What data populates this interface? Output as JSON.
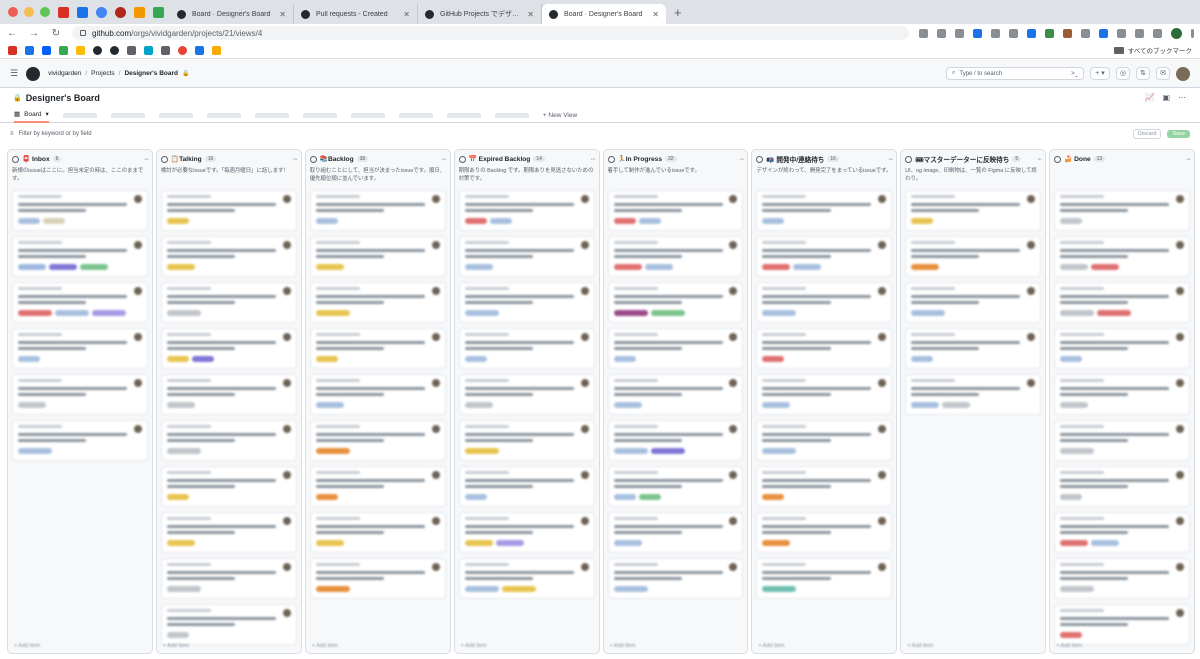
{
  "browser": {
    "tabs": [
      {
        "title": "Board · Designer's Board",
        "active": false
      },
      {
        "title": "Pull requests - Created",
        "active": false
      },
      {
        "title": "GitHub Projects でデザインチ…",
        "active": false
      },
      {
        "title": "Board · Designer's Board",
        "active": true
      }
    ],
    "new_tab": "+",
    "url_domain": "github.com",
    "url_path": "/orgs/vividgarden/projects/21/views/4",
    "bookmarks_all": "すべてのブックマーク"
  },
  "header": {
    "org": "vividgarden",
    "projects": "Projects",
    "board": "Designer's Board",
    "search_placeholder": "Type / to search"
  },
  "project": {
    "title": "Designer's Board",
    "view_tab": "Board",
    "new_view": "New View",
    "filter_placeholder": "Filter by keyword or by field",
    "discard": "Discard",
    "save": "Save"
  },
  "columns": [
    {
      "name": "📮 Inbox",
      "count": "6",
      "desc": "新規のissueはここに。担当未定の時は、ここのままです。",
      "cards": [
        {
          "labels": [
            "#a8c0e0",
            "#d8d0b8"
          ]
        },
        {
          "labels": [
            "#9fb8e0",
            "#7f76d6",
            "#7bc48c"
          ]
        },
        {
          "labels": [
            "#e07070",
            "#a8c0e0",
            "#a99ae6"
          ]
        },
        {
          "labels": [
            "#a8c0e0"
          ]
        },
        {
          "labels": [
            "#c0c6cc"
          ]
        },
        {
          "labels": [
            "#a8c0e0"
          ]
        }
      ]
    },
    {
      "name": "📋Talking",
      "count": "16",
      "desc": "検討が必要なissueです。「毎週月曜日」に話します！",
      "cards": [
        {
          "labels": [
            "#e8c44f"
          ]
        },
        {
          "labels": [
            "#e8c44f"
          ]
        },
        {
          "labels": [
            "#c0c6cc"
          ]
        },
        {
          "labels": [
            "#e8c44f",
            "#7f76d6"
          ]
        },
        {
          "labels": [
            "#c0c6cc"
          ]
        },
        {
          "labels": [
            "#c0c6cc"
          ]
        },
        {
          "labels": [
            "#e8c44f"
          ]
        },
        {
          "labels": [
            "#e8c44f"
          ]
        },
        {
          "labels": [
            "#c0c6cc"
          ]
        },
        {
          "labels": [
            "#c0c6cc"
          ]
        }
      ]
    },
    {
      "name": "📚Backlog",
      "count": "38",
      "desc": "取り組むことにして、担当が決まったissueです。順日、優先順位順に並んでいます。",
      "cards": [
        {
          "labels": [
            "#a8c0e0"
          ]
        },
        {
          "labels": [
            "#e8c44f"
          ]
        },
        {
          "labels": [
            "#e8c44f"
          ]
        },
        {
          "labels": [
            "#e8c44f"
          ]
        },
        {
          "labels": [
            "#a8c0e0"
          ]
        },
        {
          "labels": [
            "#e9903f"
          ]
        },
        {
          "labels": [
            "#e9903f"
          ]
        },
        {
          "labels": [
            "#e8c44f"
          ]
        },
        {
          "labels": [
            "#e9903f"
          ]
        }
      ]
    },
    {
      "name": "📅 Expired Backlog",
      "count": "14",
      "desc": "期限ありの Backlog です。期限ありを見逃さないための対策です。",
      "cards": [
        {
          "labels": [
            "#e07070",
            "#a8c0e0"
          ]
        },
        {
          "labels": [
            "#a8c0e0"
          ]
        },
        {
          "labels": [
            "#a8c0e0"
          ]
        },
        {
          "labels": [
            "#a8c0e0"
          ]
        },
        {
          "labels": [
            "#c0c6cc"
          ]
        },
        {
          "labels": [
            "#e8c44f"
          ]
        },
        {
          "labels": [
            "#a8c0e0"
          ]
        },
        {
          "labels": [
            "#e8c44f",
            "#a99ae6"
          ]
        },
        {
          "labels": [
            "#a8c0e0",
            "#e8c44f"
          ]
        }
      ]
    },
    {
      "name": "🏃In Progress",
      "count": "32",
      "desc": "着手して制作が進んでいるissueです。",
      "cards": [
        {
          "labels": [
            "#e07070",
            "#a8c0e0"
          ]
        },
        {
          "labels": [
            "#e07070",
            "#a8c0e0"
          ]
        },
        {
          "labels": [
            "#9b4a8a",
            "#7bc48c"
          ]
        },
        {
          "labels": [
            "#a8c0e0"
          ]
        },
        {
          "labels": [
            "#a8c0e0"
          ]
        },
        {
          "labels": [
            "#a8c0e0",
            "#7f76d6"
          ]
        },
        {
          "labels": [
            "#a8c0e0",
            "#7bc48c"
          ]
        },
        {
          "labels": [
            "#a8c0e0"
          ]
        },
        {
          "labels": [
            "#a8c0e0"
          ]
        }
      ]
    },
    {
      "name": "📭 開発中/連絡待ち",
      "count": "16",
      "desc": "デザインが終わって、開発完了をまっているissueです。",
      "cards": [
        {
          "labels": [
            "#a8c0e0"
          ]
        },
        {
          "labels": [
            "#e07070",
            "#a8c0e0"
          ]
        },
        {
          "labels": [
            "#a8c0e0"
          ]
        },
        {
          "labels": [
            "#e07070"
          ]
        },
        {
          "labels": [
            "#a8c0e0"
          ]
        },
        {
          "labels": [
            "#a8c0e0"
          ]
        },
        {
          "labels": [
            "#e9903f"
          ]
        },
        {
          "labels": [
            "#e9903f"
          ]
        },
        {
          "labels": [
            "#6fbfb0"
          ]
        }
      ]
    },
    {
      "name": "🎟マスターデーターに反映待ち",
      "count": "5",
      "desc": "UI、og image、印刷物は、一覧の Figma に反映して終わり。",
      "cards": [
        {
          "labels": [
            "#e8c44f"
          ]
        },
        {
          "labels": [
            "#e9903f"
          ]
        },
        {
          "labels": [
            "#a8c0e0"
          ]
        },
        {
          "labels": [
            "#a8c0e0"
          ]
        },
        {
          "labels": [
            "#a8c0e0",
            "#c0c6cc"
          ]
        }
      ]
    },
    {
      "name": "🍰 Done",
      "count": "13",
      "desc": "",
      "cards": [
        {
          "labels": [
            "#c0c6cc"
          ]
        },
        {
          "labels": [
            "#c0c6cc",
            "#e07070"
          ]
        },
        {
          "labels": [
            "#c0c6cc",
            "#e07070"
          ]
        },
        {
          "labels": [
            "#a8c0e0"
          ]
        },
        {
          "labels": [
            "#c0c6cc"
          ]
        },
        {
          "labels": [
            "#c0c6cc"
          ]
        },
        {
          "labels": [
            "#c0c6cc"
          ]
        },
        {
          "labels": [
            "#e07070",
            "#a8c0e0"
          ]
        },
        {
          "labels": [
            "#c0c6cc"
          ]
        },
        {
          "labels": [
            "#e07070"
          ]
        }
      ]
    }
  ],
  "add_item": "+ Add item"
}
